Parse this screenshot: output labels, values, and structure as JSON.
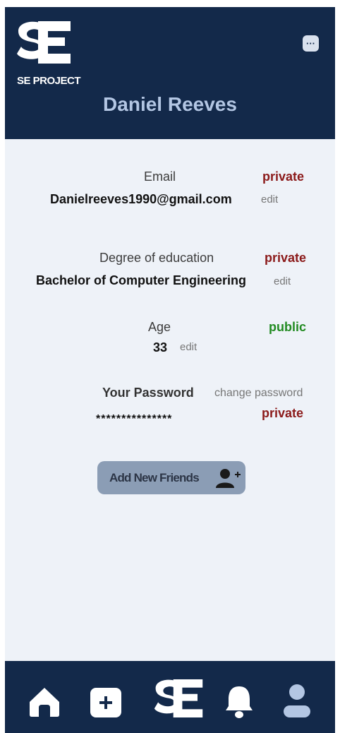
{
  "header": {
    "logo_text": "SE PROJECT",
    "menu_icon": "more-dots-icon",
    "user_name": "Daniel Reeves"
  },
  "profile": {
    "email": {
      "label": "Email",
      "value": "Danielreeves1990@gmail.com",
      "action": "edit",
      "visibility": "private"
    },
    "education": {
      "label": "Degree of education",
      "value": "Bachelor of Computer Engineering",
      "action": "edit",
      "visibility": "private"
    },
    "age": {
      "label": "Age",
      "value": "33",
      "action": "edit",
      "visibility": "public"
    },
    "password": {
      "label": "Your Password",
      "value": "***************",
      "action": "change password",
      "visibility": "private"
    }
  },
  "add_friends": {
    "label": "Add New Friends",
    "icon": "add-user-icon"
  },
  "bottom_nav": [
    "home-icon",
    "add-icon",
    "se-logo-icon",
    "bell-icon",
    "profile-icon"
  ],
  "colors": {
    "navy": "#13294a",
    "private": "#8b1a1a",
    "public": "#228b22",
    "button": "#8b9db5"
  }
}
